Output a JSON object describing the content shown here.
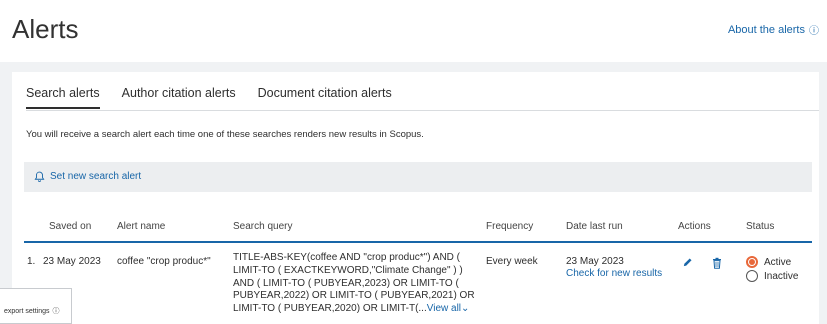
{
  "header": {
    "title": "Alerts",
    "about_link": "About the alerts"
  },
  "tabs": [
    {
      "label": "Search alerts",
      "active": true
    },
    {
      "label": "Author citation alerts",
      "active": false
    },
    {
      "label": "Document citation alerts",
      "active": false
    }
  ],
  "info_text": "You will receive a search alert each time one of these searches renders new results in Scopus.",
  "new_alert_label": "Set new search alert",
  "table": {
    "headers": {
      "saved_on": "Saved on",
      "alert_name": "Alert name",
      "search_query": "Search query",
      "frequency": "Frequency",
      "date_last_run": "Date last run",
      "actions": "Actions",
      "status": "Status"
    },
    "rows": [
      {
        "index": "1.",
        "saved_on": "23 May 2023",
        "alert_name": "coffee \"crop produc*\"",
        "query_lines": [
          "TITLE-ABS-KEY(coffee AND \"crop produc*\") AND (",
          "LIMIT-TO ( EXACTKEYWORD,\"Climate Change\" ) )",
          "AND ( LIMIT-TO ( PUBYEAR,2023) OR LIMIT-TO (",
          "PUBYEAR,2022) OR LIMIT-TO ( PUBYEAR,2021) OR",
          "LIMIT-TO ( PUBYEAR,2020) OR LIMIT-T(..."
        ],
        "view_all": "View all",
        "frequency": "Every week",
        "date_last_run": "23 May 2023",
        "check_link": "Check for new results",
        "status_active": "Active",
        "status_inactive": "Inactive",
        "selected_status": "Active"
      }
    ]
  },
  "export_settings": "export settings",
  "colors": {
    "link": "#1866a8",
    "active_radio": "#e8683a",
    "header_rule": "#1866a8",
    "background": "#f0f2f4"
  },
  "icons": [
    "info-icon",
    "bell-icon",
    "pencil-icon",
    "trash-icon",
    "chevron-down-icon"
  ]
}
